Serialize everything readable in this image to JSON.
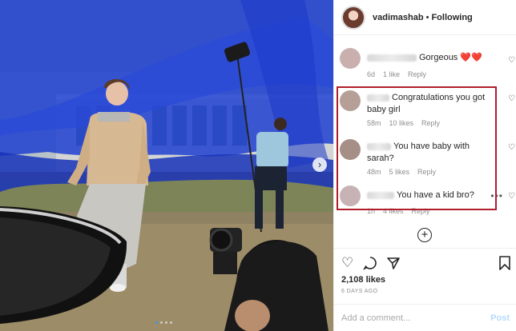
{
  "header": {
    "username": "vadimashab",
    "separator": "•",
    "follow_label": "Following"
  },
  "comments": [
    {
      "text": "Gorgeous ❤️❤️",
      "time": "6d",
      "likes": "1 like",
      "reply": "Reply"
    },
    {
      "text": "Congratulations you got baby girl",
      "time": "58m",
      "likes": "10 likes",
      "reply": "Reply"
    },
    {
      "text": "You have baby with sarah?",
      "time": "48m",
      "likes": "5 likes",
      "reply": "Reply"
    },
    {
      "text": "You have a kid bro?",
      "time": "1h",
      "likes": "4 likes",
      "reply": "Reply"
    }
  ],
  "actions": {
    "like_icon": "heart-outline-icon",
    "comment_icon": "comment-bubble-icon",
    "share_icon": "paper-plane-icon",
    "save_icon": "bookmark-icon"
  },
  "likes_count": "2,108 likes",
  "post_date": "6 DAYS AGO",
  "comment_box": {
    "placeholder": "Add a comment...",
    "post_label": "Post"
  },
  "colors": {
    "highlight_border": "#b01e2a",
    "link_blue": "#3897f0"
  }
}
